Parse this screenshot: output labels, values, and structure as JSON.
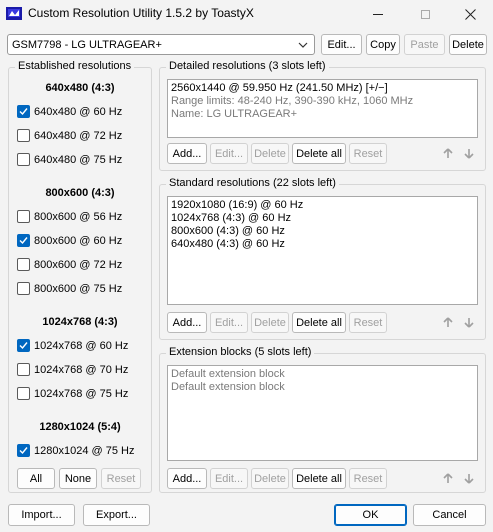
{
  "window": {
    "title": "Custom Resolution Utility 1.5.2 by ToastyX",
    "controls": {
      "minimize": "minimize",
      "maximize": "maximize",
      "close": "close"
    }
  },
  "monitor_select": {
    "value": "GSM7798 - LG ULTRAGEAR+"
  },
  "top_buttons": {
    "edit": "Edit...",
    "copy": "Copy",
    "paste": "Paste",
    "delete": "Delete"
  },
  "established": {
    "title": "Established resolutions",
    "sections": [
      {
        "header": "640x480 (4:3)",
        "items": [
          {
            "label": "640x480 @ 60 Hz",
            "checked": true
          },
          {
            "label": "640x480 @ 72 Hz",
            "checked": false
          },
          {
            "label": "640x480 @ 75 Hz",
            "checked": false
          }
        ]
      },
      {
        "header": "800x600 (4:3)",
        "items": [
          {
            "label": "800x600 @ 56 Hz",
            "checked": false
          },
          {
            "label": "800x600 @ 60 Hz",
            "checked": true
          },
          {
            "label": "800x600 @ 72 Hz",
            "checked": false
          },
          {
            "label": "800x600 @ 75 Hz",
            "checked": false
          }
        ]
      },
      {
        "header": "1024x768 (4:3)",
        "items": [
          {
            "label": "1024x768 @ 60 Hz",
            "checked": true
          },
          {
            "label": "1024x768 @ 70 Hz",
            "checked": false
          },
          {
            "label": "1024x768 @ 75 Hz",
            "checked": false
          }
        ]
      },
      {
        "header": "1280x1024 (5:4)",
        "items": [
          {
            "label": "1280x1024 @ 75 Hz",
            "checked": true
          }
        ]
      }
    ],
    "buttons": {
      "all": "All",
      "none": "None",
      "reset": "Reset"
    }
  },
  "detailed": {
    "title": "Detailed resolutions (3 slots left)",
    "lines": [
      "2560x1440 @ 59.950 Hz (241.50 MHz) [+/−]",
      "Range limits: 48-240 Hz, 390-390 kHz, 1060 MHz",
      "Name: LG ULTRAGEAR+"
    ],
    "buttons": {
      "add": "Add...",
      "edit": "Edit...",
      "delete": "Delete",
      "delete_all": "Delete all",
      "reset": "Reset"
    }
  },
  "standard": {
    "title": "Standard resolutions (22 slots left)",
    "lines": [
      "1920x1080 (16:9) @ 60 Hz",
      "1024x768 (4:3) @ 60 Hz",
      "800x600 (4:3) @ 60 Hz",
      "640x480 (4:3) @ 60 Hz"
    ],
    "buttons": {
      "add": "Add...",
      "edit": "Edit...",
      "delete": "Delete",
      "delete_all": "Delete all",
      "reset": "Reset"
    }
  },
  "extension": {
    "title": "Extension blocks (5 slots left)",
    "lines": [
      "Default extension block",
      "Default extension block"
    ],
    "buttons": {
      "add": "Add...",
      "edit": "Edit...",
      "delete": "Delete",
      "delete_all": "Delete all",
      "reset": "Reset"
    }
  },
  "bottom_buttons": {
    "import": "Import...",
    "export": "Export...",
    "ok": "OK",
    "cancel": "Cancel"
  },
  "colors": {
    "accent": "#0067c0",
    "icon_blue": "#1a1aa8",
    "disabled_text": "#a0a0a0"
  }
}
